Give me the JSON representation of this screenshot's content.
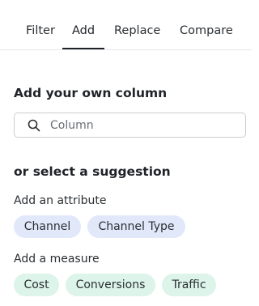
{
  "tabs": [
    {
      "label": "Filter",
      "active": false
    },
    {
      "label": "Add",
      "active": true
    },
    {
      "label": "Replace",
      "active": false
    },
    {
      "label": "Compare",
      "active": false
    }
  ],
  "own_column": {
    "heading": "Add your own column",
    "search": {
      "icon": "search-icon",
      "placeholder": "Column",
      "value": ""
    }
  },
  "suggestions": {
    "heading": "or select a suggestion",
    "attributes": {
      "label": "Add an attribute",
      "chips": [
        "Channel",
        "Channel Type"
      ],
      "color": "#e1e8fa"
    },
    "measures": {
      "label": "Add a measure",
      "chips": [
        "Cost",
        "Conversions",
        "Traffic"
      ],
      "color": "#dcf4ea"
    }
  }
}
